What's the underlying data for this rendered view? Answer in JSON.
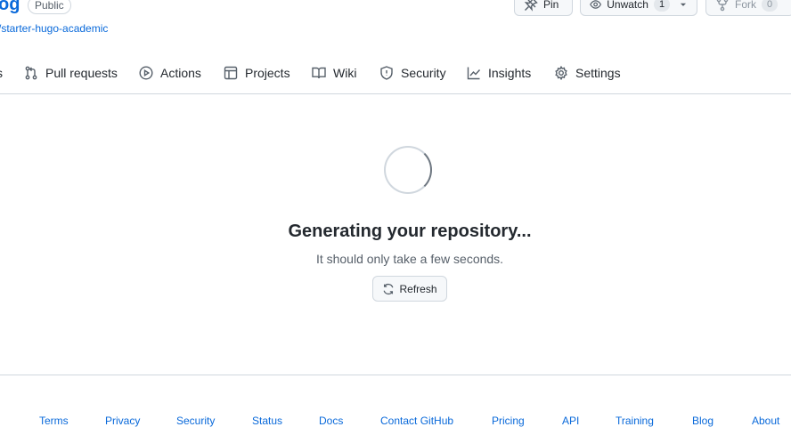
{
  "repo": {
    "name_fragment": "og",
    "visibility": "Public",
    "forked_from_fragment": "/starter-hugo-academic"
  },
  "actions": {
    "pin_label": "Pin",
    "unwatch_label": "Unwatch",
    "watch_count": "1",
    "fork_label": "Fork",
    "fork_count": "0"
  },
  "tabs": [
    {
      "label": "s",
      "icon": "code-icon"
    },
    {
      "label": "Pull requests",
      "icon": "pull-request-icon"
    },
    {
      "label": "Actions",
      "icon": "play-icon"
    },
    {
      "label": "Projects",
      "icon": "table-icon"
    },
    {
      "label": "Wiki",
      "icon": "book-icon"
    },
    {
      "label": "Security",
      "icon": "shield-icon"
    },
    {
      "label": "Insights",
      "icon": "graph-icon"
    },
    {
      "label": "Settings",
      "icon": "gear-icon"
    }
  ],
  "loading": {
    "title": "Generating your repository...",
    "subtitle": "It should only take a few seconds.",
    "refresh_label": "Refresh"
  },
  "footer": {
    "links": [
      "Terms",
      "Privacy",
      "Security",
      "Status",
      "Docs",
      "Contact GitHub",
      "Pricing",
      "API",
      "Training",
      "Blog",
      "About"
    ]
  },
  "colors": {
    "link": "#0969da",
    "border": "#d0d7de",
    "text": "#24292f",
    "muted": "#57606a"
  }
}
